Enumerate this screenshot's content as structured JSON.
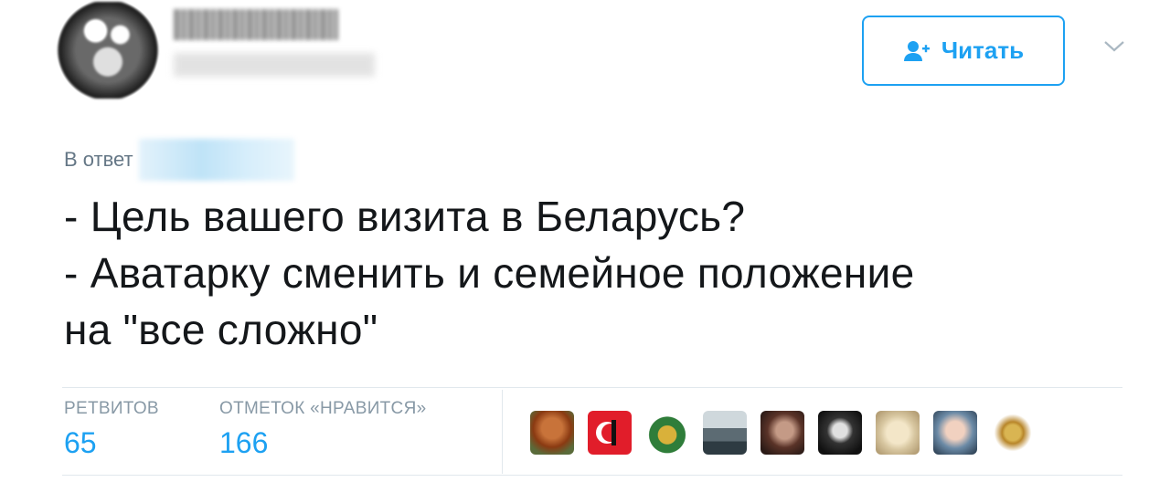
{
  "header": {
    "follow_label": "Читать"
  },
  "reply": {
    "prefix": "В ответ"
  },
  "tweet": {
    "lines": [
      "- Цель вашего визита в Беларусь?",
      "- Аватарку сменить и семейное положение",
      "на \"все сложно\""
    ]
  },
  "stats": {
    "retweets_label": "РЕТВИТОВ",
    "retweets_value": "65",
    "likes_label": "ОТМЕТОК «НРАВИТСЯ»",
    "likes_value": "166"
  },
  "colors": {
    "accent": "#1da1f2",
    "muted": "#657786",
    "text": "#14171a",
    "divider": "#e1e8ed"
  },
  "icons": {
    "follow": "add-user-icon",
    "menu": "chevron-down-icon"
  }
}
